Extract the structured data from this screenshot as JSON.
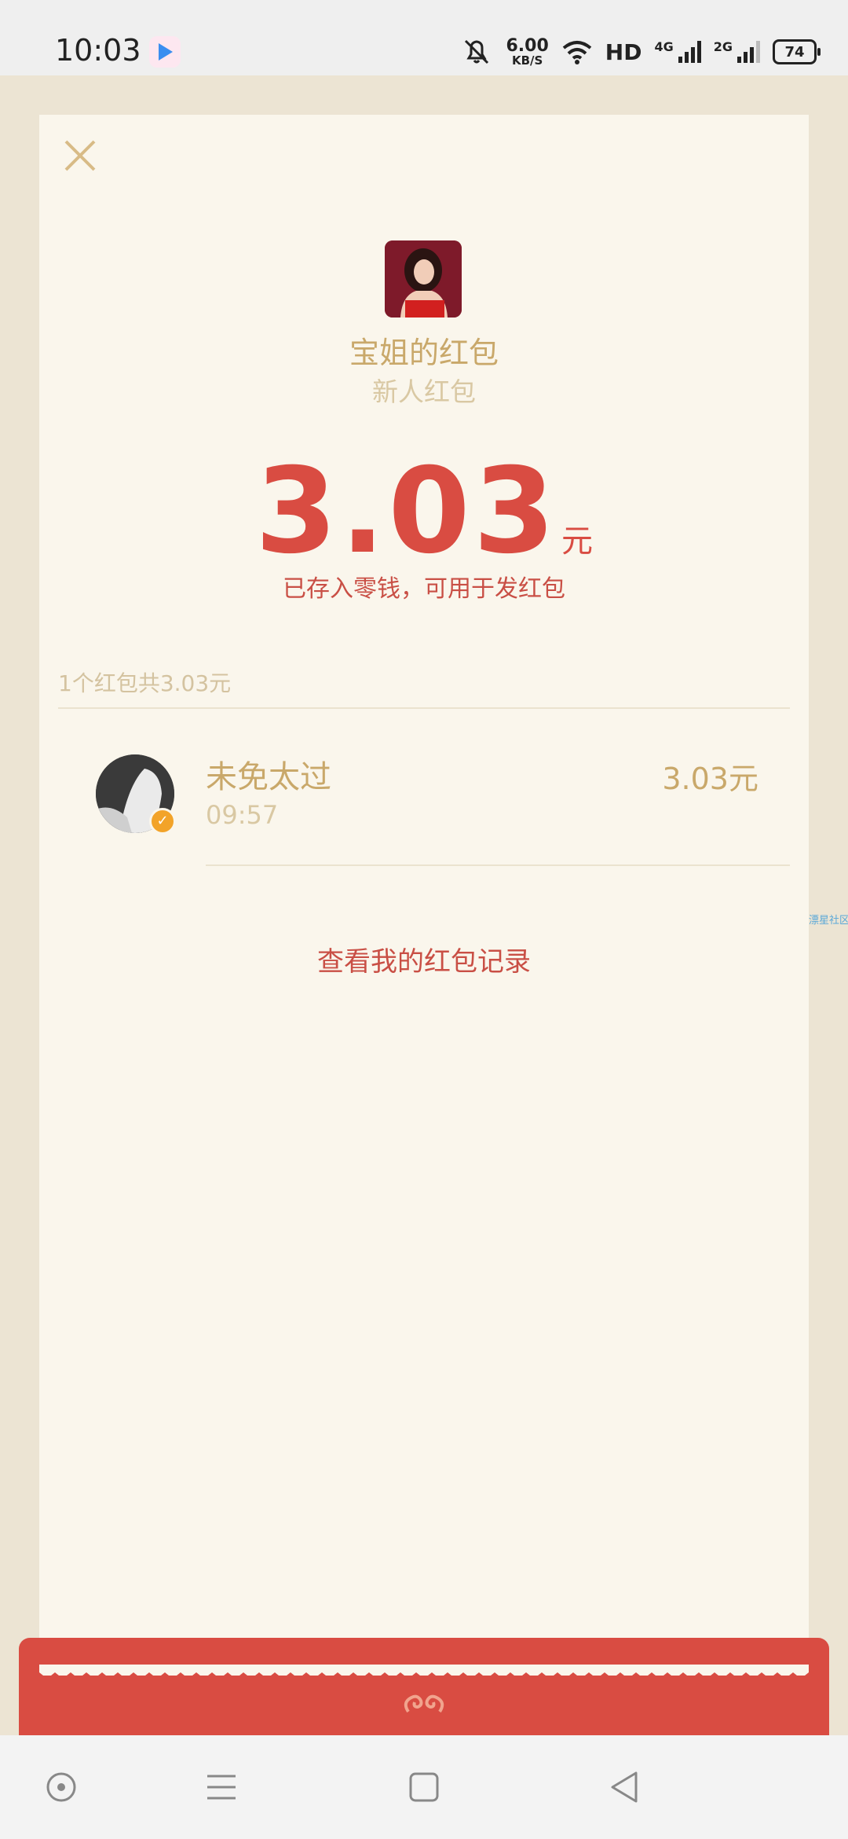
{
  "status_bar": {
    "time": "10:03",
    "net_speed_value": "6.00",
    "net_speed_unit": "KB/S",
    "hd_label": "HD",
    "net_4g": "4G",
    "net_2g": "2G",
    "battery": "74"
  },
  "envelope": {
    "sender_name": "宝姐的红包",
    "subtitle": "新人红包",
    "amount": "3.03",
    "unit": "元",
    "saved_note": "已存入零钱，可用于发红包"
  },
  "summary": "1个红包共3.03元",
  "receivers": [
    {
      "name": "未免太过",
      "time": "09:57",
      "amount": "3.03元"
    }
  ],
  "records_link": "查看我的红包记录",
  "watermark": "漂星社区",
  "colors": {
    "amount_red": "#d94c42",
    "gold_text": "#c9a86a",
    "card_bg": "#faf6ec",
    "page_bg": "#ece4d3"
  }
}
